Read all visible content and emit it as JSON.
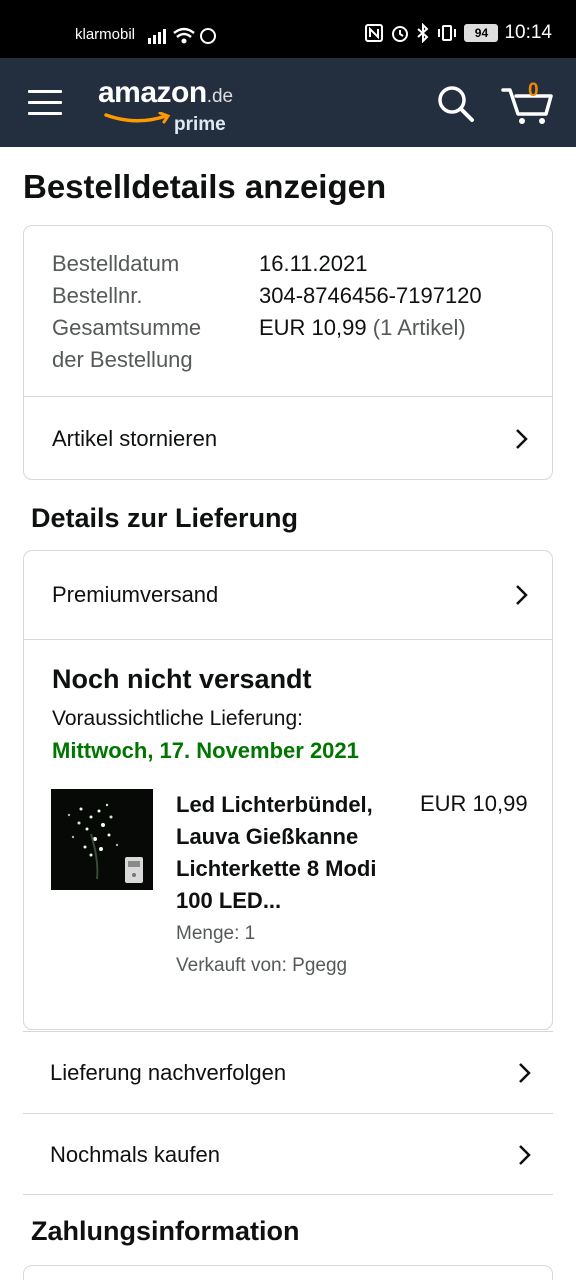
{
  "status_bar": {
    "carrier": "klarmobil",
    "battery": "94",
    "time": "10:14"
  },
  "header": {
    "logo_word": "amazon",
    "logo_tld": ".de",
    "logo_sub": "prime",
    "cart_count": "0",
    "icons": [
      "menu-icon",
      "search-icon",
      "cart-icon"
    ]
  },
  "page": {
    "title": "Bestelldetails anzeigen"
  },
  "order_summary": {
    "date_label": "Bestelldatum",
    "date_value": "16.11.2021",
    "number_label": "Bestellnr.",
    "number_value": "304-8746456-7197120",
    "total_label_line1": "Gesamtsumme",
    "total_label_line2": "der Bestellung",
    "total_value": "EUR 10,99",
    "total_items": "(1 Artikel)",
    "cancel_label": "Artikel stornieren"
  },
  "delivery": {
    "section_title": "Details zur Lieferung",
    "shipping_method": "Premiumversand",
    "status": "Noch nicht versandt",
    "eta_label": "Voraussichtliche Lieferung:",
    "eta_date": "Mittwoch, 17. November 2021",
    "item": {
      "title": "Led Lichterbündel, Lauva Gießkanne Lichterkette 8 Modi 100 LED...",
      "price": "EUR 10,99",
      "quantity": "Menge: 1",
      "seller": "Verkauft von: Pgegg"
    }
  },
  "actions": {
    "track": "Lieferung nachverfolgen",
    "buy_again": "Nochmals kaufen"
  },
  "payment": {
    "section_title": "Zahlungsinformation"
  },
  "colors": {
    "header_bg": "#232f3e",
    "eta_green": "#007600",
    "cart_orange": "#f08804",
    "smile_orange": "#ff9900"
  }
}
